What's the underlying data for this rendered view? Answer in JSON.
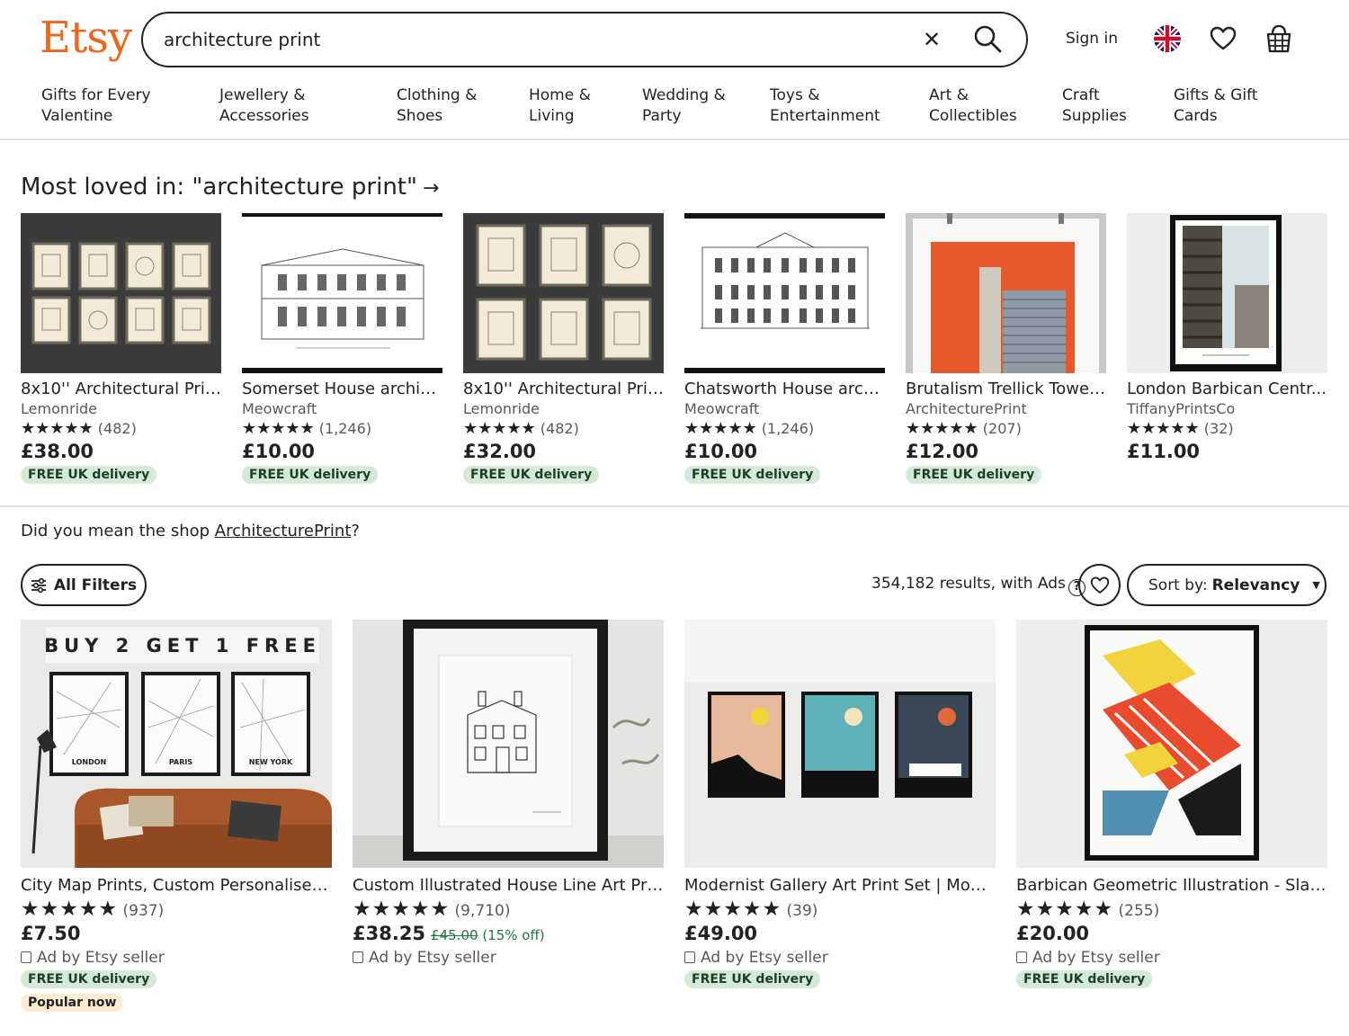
{
  "header": {
    "logo": "Etsy",
    "search_value": "architecture print",
    "signin": "Sign in",
    "clear_icon": "close-icon",
    "search_icon": "search-icon"
  },
  "categories": [
    "Gifts for Every\nValentine",
    "Jewellery &\nAccessories",
    "Clothing &\nShoes",
    "Home &\nLiving",
    "Wedding &\nParty",
    "Toys &\nEntertainment",
    "Art &\nCollectibles",
    "Craft\nSupplies",
    "Gifts & Gift\nCards"
  ],
  "most_loved": {
    "title": "Most loved in: \"architecture print\"",
    "arrow": "→",
    "items": [
      {
        "title": "8x10'' Architectural Prin...",
        "shop": "Lemonride",
        "stars": "★★★★★",
        "reviews": "(482)",
        "price": "£38.00",
        "badge": "FREE UK delivery"
      },
      {
        "title": "Somerset House archite...",
        "shop": "Meowcraft",
        "stars": "★★★★★",
        "reviews": "(1,246)",
        "price": "£10.00",
        "badge": "FREE UK delivery"
      },
      {
        "title": "8x10'' Architectural Prin...",
        "shop": "Lemonride",
        "stars": "★★★★★",
        "reviews": "(482)",
        "price": "£32.00",
        "badge": "FREE UK delivery"
      },
      {
        "title": "Chatsworth House archi...",
        "shop": "Meowcraft",
        "stars": "★★★★★",
        "reviews": "(1,246)",
        "price": "£10.00",
        "badge": "FREE UK delivery"
      },
      {
        "title": "Brutalism Trellick Tower ...",
        "shop": "ArchitecturePrint",
        "stars": "★★★★★",
        "reviews": "(207)",
        "price": "£12.00",
        "badge": "FREE UK delivery"
      },
      {
        "title": "London Barbican Centr...",
        "shop": "TiffanyPrintsCo",
        "stars": "★★★★★",
        "reviews": "(32)",
        "price": "£11.00",
        "badge": ""
      }
    ]
  },
  "did_you_mean": {
    "prefix": "Did you mean the shop ",
    "shop": "ArchitecturePrint",
    "suffix": "?"
  },
  "toolbar": {
    "filters": "All Filters",
    "results": "354,182 results, with Ads",
    "help": "?",
    "sort_label": "Sort by:",
    "sort_value": "Relevancy",
    "caret": "▼"
  },
  "results": [
    {
      "image_text": "BUY 2 GET 1 FREE",
      "map_labels": [
        "LONDON",
        "PARIS",
        "NEW YORK"
      ],
      "title": "City Map Prints, Custom Personalised, ...",
      "stars": "★★★★★",
      "reviews": "(937)",
      "price": "£7.50",
      "original": "",
      "discount": "",
      "ad": "Ad by Etsy seller",
      "badge": "FREE UK delivery",
      "badge2": "Popular now"
    },
    {
      "title": "Custom Illustrated House Line Art Prin...",
      "stars": "★★★★★",
      "reviews": "(9,710)",
      "price": "£38.25",
      "original": "£45.00",
      "discount": "(15% off)",
      "ad": "Ad by Etsy seller",
      "badge": "",
      "badge2": ""
    },
    {
      "title": "Modernist Gallery Art Print Set | Moder...",
      "stars": "★★★★★",
      "reviews": "(39)",
      "price": "£49.00",
      "original": "",
      "discount": "",
      "ad": "Ad by Etsy seller",
      "badge": "FREE UK delivery",
      "badge2": ""
    },
    {
      "title": "Barbican Geometric Illustration - Slab ...",
      "stars": "★★★★★",
      "reviews": "(255)",
      "price": "£20.00",
      "original": "",
      "discount": "",
      "ad": "Ad by Etsy seller",
      "badge": "FREE UK delivery",
      "badge2": ""
    }
  ],
  "colors": {
    "brand": "#f1641e",
    "badge_green": "#d4e9d7",
    "badge_popular": "#fdebd2"
  }
}
